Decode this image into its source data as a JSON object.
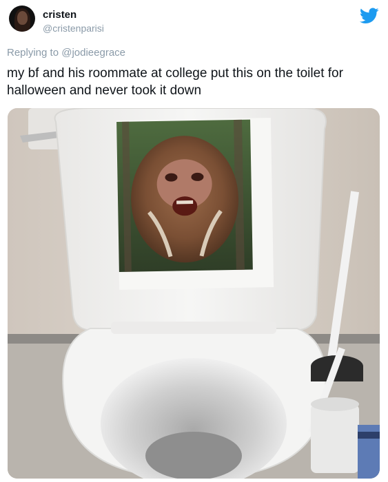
{
  "tweet": {
    "display_name": "cristen",
    "handle": "@cristenparisi",
    "reply_prefix": "Replying to",
    "reply_to": "@jodieegrace",
    "text": "my bf and his roommate at college put this on the toilet for halloween and never took it down"
  },
  "icons": {
    "brand": "twitter-bird-icon"
  },
  "colors": {
    "twitter_blue": "#1d9bf0",
    "secondary_text": "#8a9aa8",
    "primary_text": "#0f1419"
  }
}
